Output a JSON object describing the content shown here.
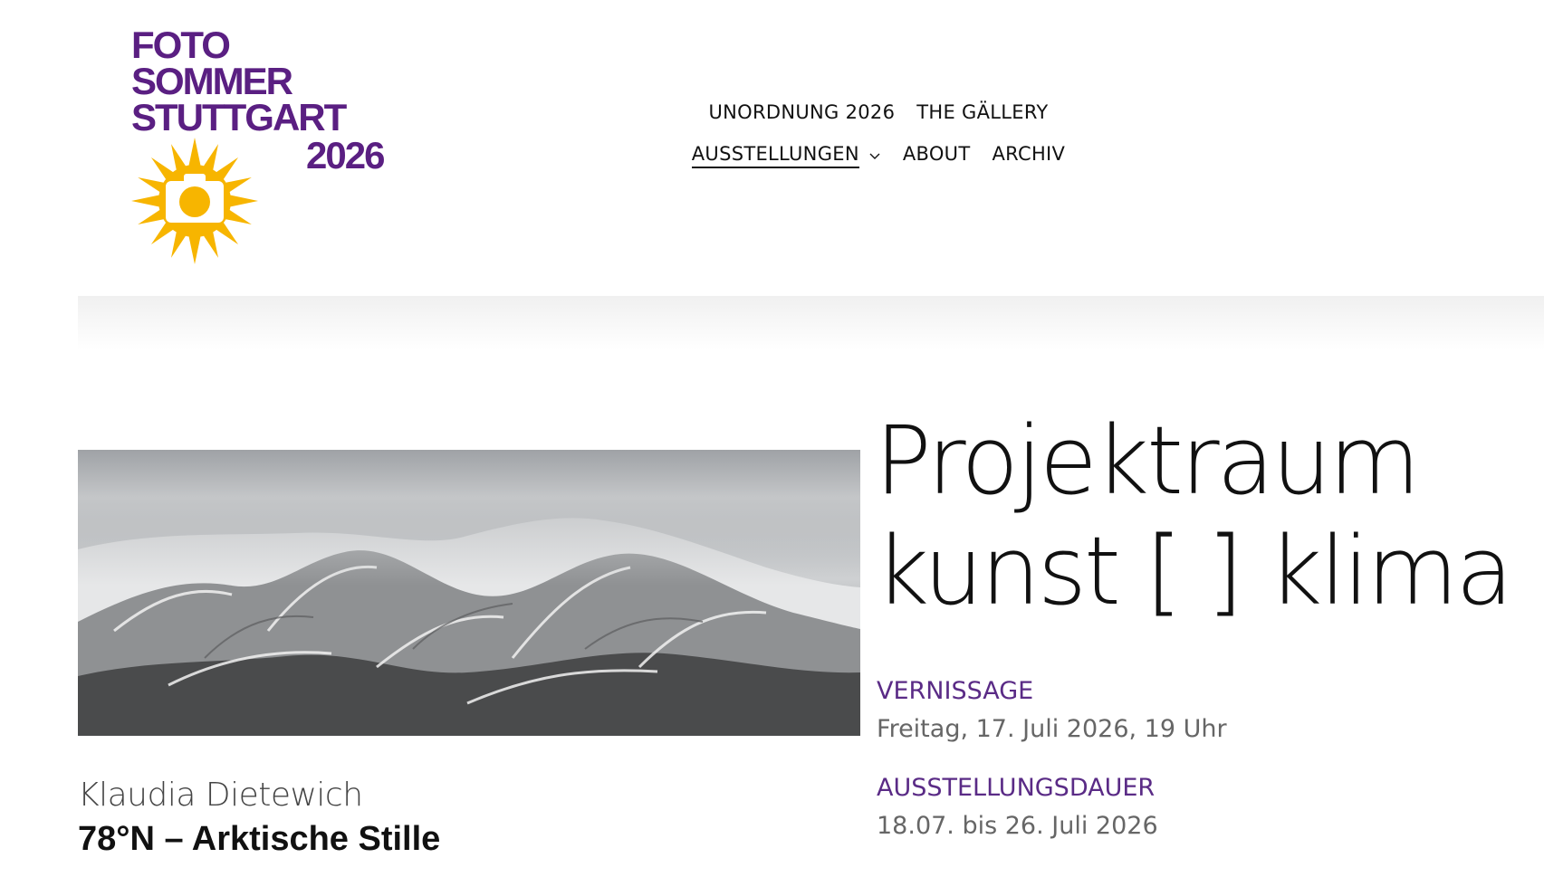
{
  "logo": {
    "lines": [
      "FOTO",
      "SOMMER",
      "STUTTGART"
    ],
    "year": "2026",
    "colors": {
      "text": "#5a1f82",
      "sun": "#f7b500"
    },
    "icon": "camera-sun-icon"
  },
  "nav": {
    "row1": [
      {
        "label": "UNORDNUNG 2026"
      },
      {
        "label": "THE GÄLLERY"
      }
    ],
    "row2": [
      {
        "label": "AUSSTELLUNGEN",
        "active": true,
        "dropdown": true
      },
      {
        "label": "ABOUT"
      },
      {
        "label": "ARCHIV"
      }
    ]
  },
  "exhibition": {
    "headline_line1": "Projektraum",
    "headline_line2": "kunst [ ] klima",
    "artist": "Klaudia Dietewich",
    "title": "78°N – Arktische Stille",
    "opening_label": "VERNISSAGE",
    "opening_value": "Freitag, 17. Juli 2026, 19 Uhr",
    "duration_label": "AUSSTELLUNGSDAUER",
    "duration_value": "18.07. bis 26. Juli 2026",
    "accent_color": "#5a2b86"
  }
}
